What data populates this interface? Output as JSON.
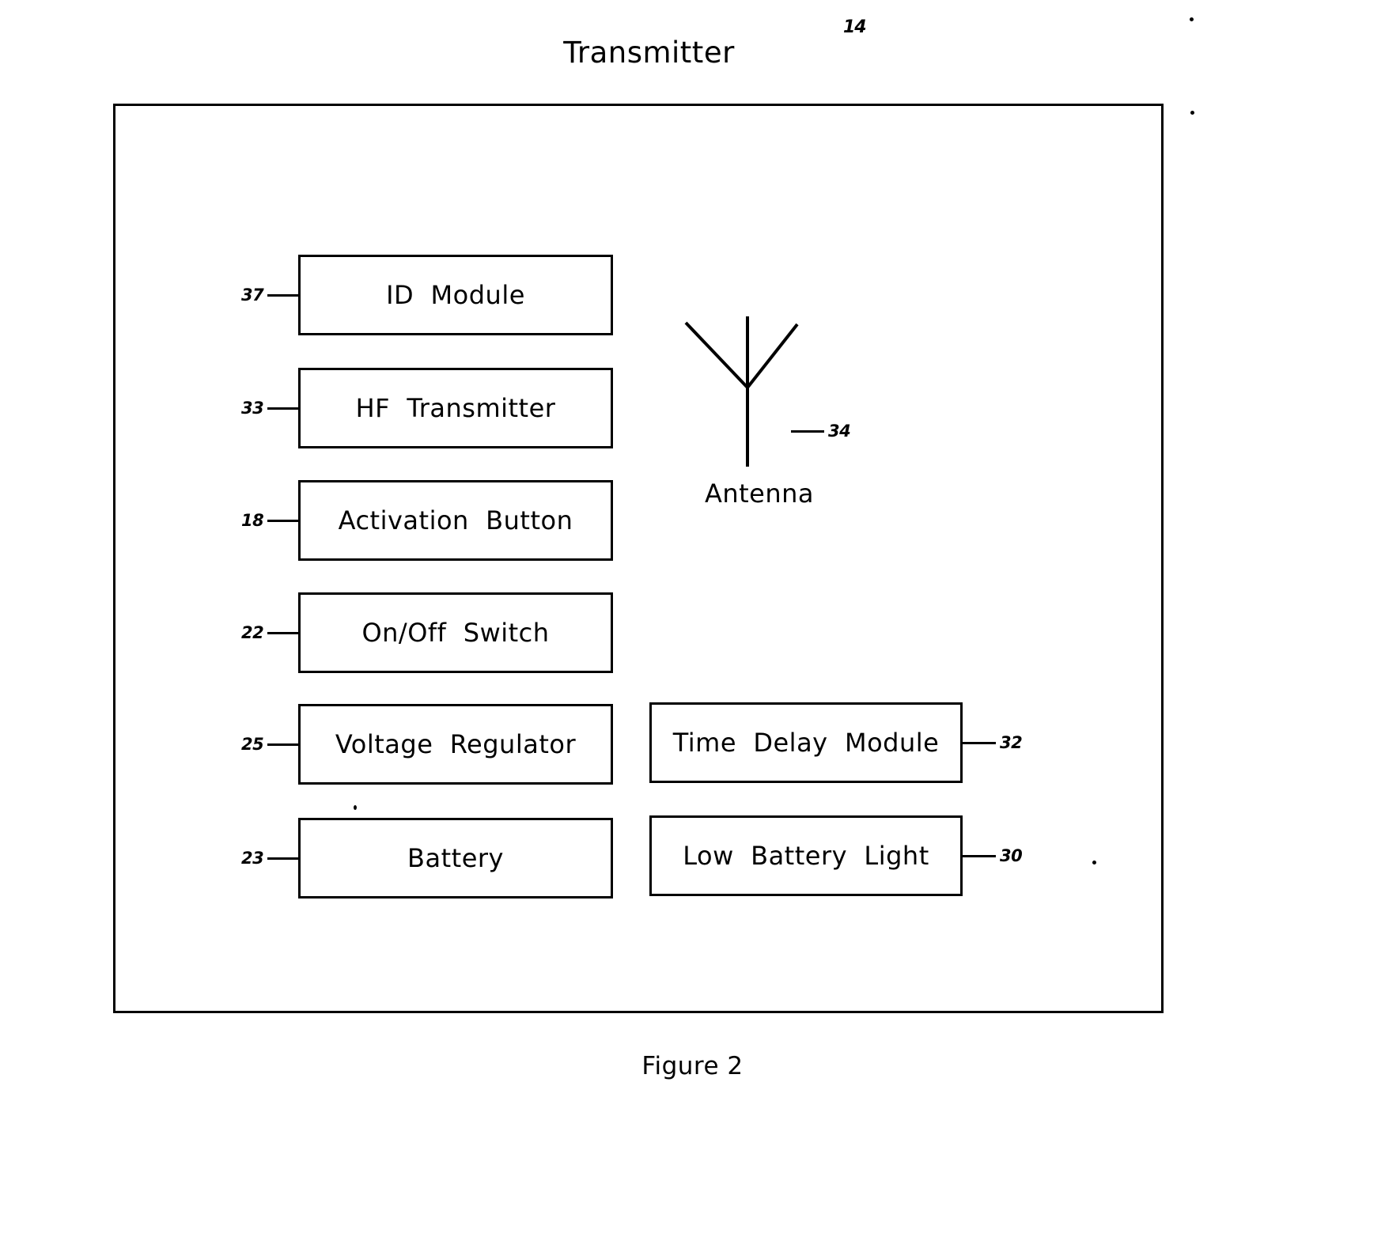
{
  "figure": {
    "title": "Transmitter",
    "title_ref_numeral": "14",
    "caption": "Figure  2"
  },
  "enclosure": {
    "name": "transmitter-enclosure"
  },
  "left_column": [
    {
      "ref": "37",
      "label": "ID  Module",
      "name": "id-module"
    },
    {
      "ref": "33",
      "label": "HF  Transmitter",
      "name": "hf-transmitter"
    },
    {
      "ref": "18",
      "label": "Activation  Button",
      "name": "activation-button"
    },
    {
      "ref": "22",
      "label": "On/Off  Switch",
      "name": "onoff-switch"
    },
    {
      "ref": "25",
      "label": "Voltage  Regulator",
      "name": "voltage-regulator"
    },
    {
      "ref": "23",
      "label": "Battery",
      "name": "battery"
    }
  ],
  "right_column": [
    {
      "ref": "32",
      "label": "Time  Delay  Module",
      "name": "time-delay-module"
    },
    {
      "ref": "30",
      "label": "Low  Battery  Light",
      "name": "low-battery-light"
    }
  ],
  "antenna": {
    "label": "Antenna",
    "ref": "34",
    "icon": "antenna-icon"
  },
  "colors": {
    "ink": "#000000",
    "paper": "#ffffff"
  }
}
